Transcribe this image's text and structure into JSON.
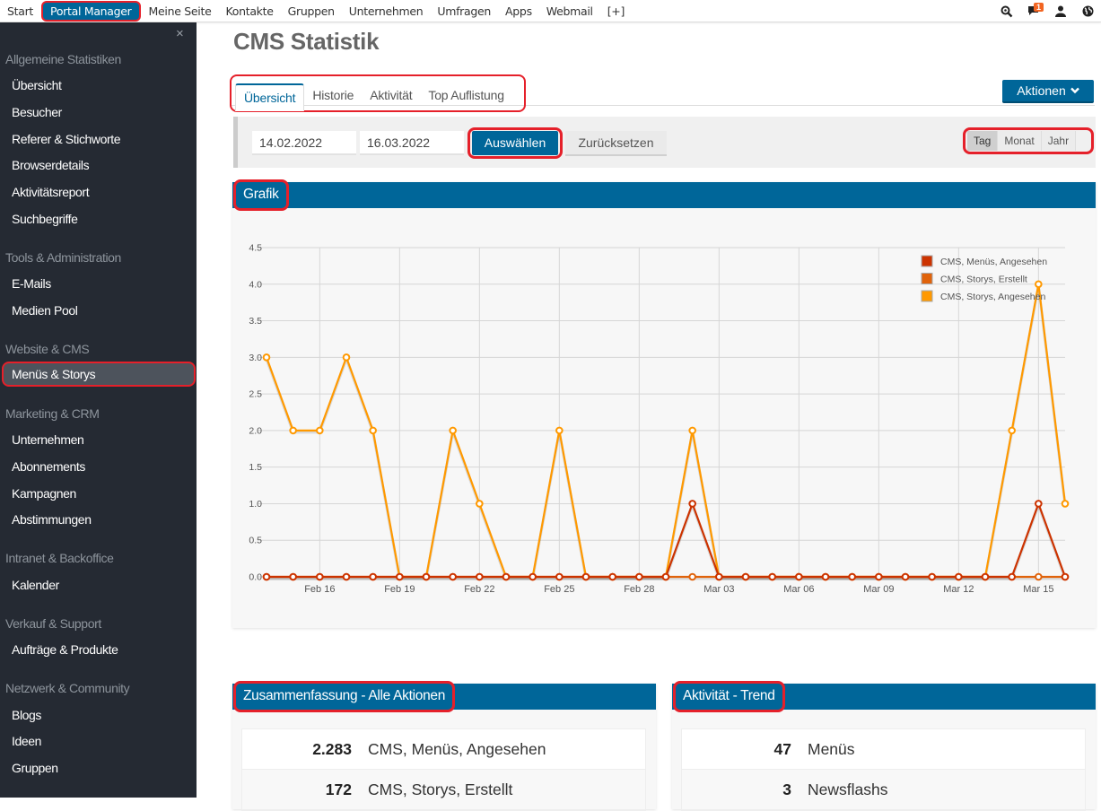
{
  "topnav": {
    "items": [
      "Start",
      "Portal Manager",
      "Meine Seite",
      "Kontakte",
      "Gruppen",
      "Unternehmen",
      "Umfragen",
      "Apps",
      "Webmail",
      "[+]"
    ],
    "active": "Portal Manager",
    "notification_count": "1",
    "icons": [
      "search-icon",
      "chat-icon",
      "user-icon",
      "globe-icon"
    ]
  },
  "sidebar": {
    "close": "×",
    "groups": [
      {
        "title": "Allgemeine Statistiken",
        "items": [
          "Übersicht",
          "Besucher",
          "Referer & Stichworte",
          "Browserdetails",
          "Aktivitätsreport",
          "Suchbegriffe"
        ]
      },
      {
        "title": "Tools & Administration",
        "items": [
          "E-Mails",
          "Medien Pool"
        ]
      },
      {
        "title": "Website & CMS",
        "items": [
          "Menüs & Storys"
        ]
      },
      {
        "title": "Marketing & CRM",
        "items": [
          "Unternehmen",
          "Abonnements",
          "Kampagnen",
          "Abstimmungen"
        ]
      },
      {
        "title": "Intranet & Backoffice",
        "items": [
          "Kalender"
        ]
      },
      {
        "title": "Verkauf & Support",
        "items": [
          "Aufträge & Produkte"
        ]
      },
      {
        "title": "Netzwerk & Community",
        "items": [
          "Blogs",
          "Ideen",
          "Gruppen"
        ]
      }
    ],
    "active_item": "Menüs & Storys"
  },
  "page": {
    "title": "CMS Statistik",
    "tabs": [
      "Übersicht",
      "Historie",
      "Aktivität",
      "Top Auflistung"
    ],
    "active_tab": "Übersicht",
    "actions_label": "Aktionen",
    "filter": {
      "date_from": "14.02.2022",
      "date_to": "16.03.2022",
      "select_label": "Auswählen",
      "reset_label": "Zurücksetzen",
      "periods": [
        "Tag",
        "Monat",
        "Jahr"
      ],
      "active_period": "Tag"
    }
  },
  "chart_panel": {
    "title": "Grafik"
  },
  "chart_data": {
    "type": "line",
    "title": "",
    "xlabel": "",
    "ylabel": "",
    "ylim": [
      0,
      4.5
    ],
    "yticks": [
      "0.0",
      "0.5",
      "1.0",
      "1.5",
      "2.0",
      "2.5",
      "3.0",
      "3.5",
      "4.0",
      "4.5"
    ],
    "x": [
      "Feb 14",
      "Feb 15",
      "Feb 16",
      "Feb 17",
      "Feb 18",
      "Feb 19",
      "Feb 20",
      "Feb 21",
      "Feb 22",
      "Feb 23",
      "Feb 24",
      "Feb 25",
      "Feb 26",
      "Feb 27",
      "Feb 28",
      "Mar 01",
      "Mar 02",
      "Mar 03",
      "Mar 04",
      "Mar 05",
      "Mar 06",
      "Mar 07",
      "Mar 08",
      "Mar 09",
      "Mar 10",
      "Mar 11",
      "Mar 12",
      "Mar 13",
      "Mar 14",
      "Mar 15",
      "Mar 16"
    ],
    "xtick_labels": [
      "Feb 16",
      "Feb 19",
      "Feb 22",
      "Feb 25",
      "Feb 28",
      "Mar 03",
      "Mar 06",
      "Mar 09",
      "Mar 12",
      "Mar 15"
    ],
    "grid": true,
    "legend_position": "top-right",
    "series": [
      {
        "name": "CMS, Menüs, Angesehen",
        "color": "#cc3300",
        "values": [
          0,
          0,
          0,
          0,
          0,
          0,
          0,
          0,
          0,
          0,
          0,
          0,
          0,
          0,
          0,
          0,
          1,
          0,
          0,
          0,
          0,
          0,
          0,
          0,
          0,
          0,
          0,
          0,
          0,
          1,
          0
        ]
      },
      {
        "name": "CMS, Storys, Erstellt",
        "color": "#e0630b",
        "values": [
          0,
          0,
          0,
          0,
          0,
          0,
          0,
          0,
          0,
          0,
          0,
          0,
          0,
          0,
          0,
          0,
          0,
          0,
          0,
          0,
          0,
          0,
          0,
          0,
          0,
          0,
          0,
          0,
          0,
          0,
          0
        ]
      },
      {
        "name": "CMS, Storys, Angesehen",
        "color": "#ff9900",
        "values": [
          3,
          2,
          2,
          3,
          2,
          0,
          0,
          2,
          1,
          0,
          0,
          2,
          0,
          0,
          0,
          0,
          2,
          0,
          0,
          0,
          0,
          0,
          0,
          0,
          0,
          0,
          0,
          0,
          2,
          4,
          1
        ]
      }
    ]
  },
  "summary_panel": {
    "title": "Zusammenfassung - Alle Aktionen",
    "rows": [
      {
        "value": "2.283",
        "label": "CMS, Menüs, Angesehen"
      },
      {
        "value": "172",
        "label": "CMS, Storys, Erstellt"
      }
    ]
  },
  "trend_panel": {
    "title": "Aktivität - Trend",
    "rows": [
      {
        "value": "47",
        "label": "Menüs"
      },
      {
        "value": "3",
        "label": "Newsflashs"
      }
    ]
  }
}
